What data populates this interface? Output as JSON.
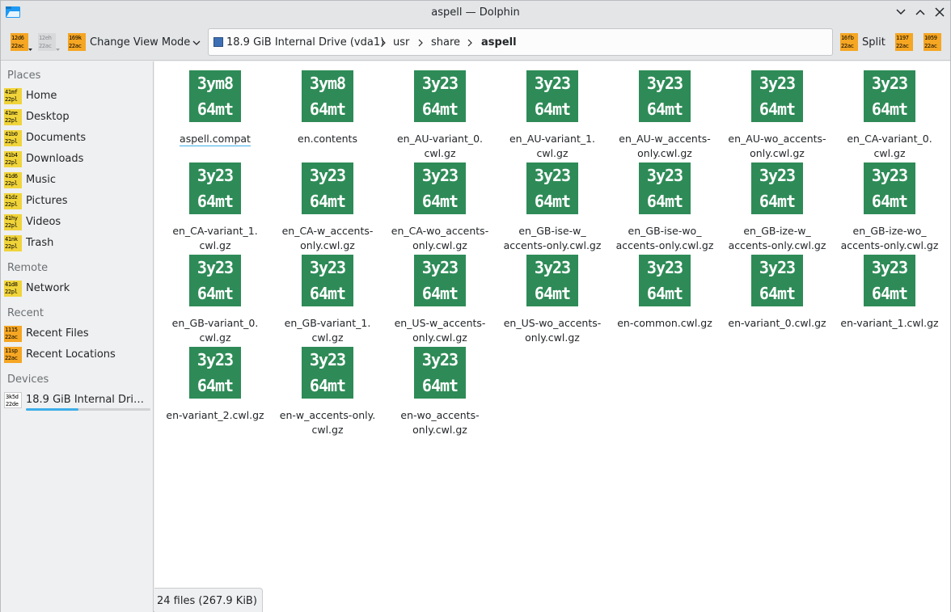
{
  "window": {
    "title": "aspell — Dolphin"
  },
  "toolbar": {
    "back_icon": [
      "12d6",
      "22ac"
    ],
    "forward_icon": [
      "12eh",
      "22ac"
    ],
    "view_mode_icon": [
      "169k",
      "22ac"
    ],
    "view_mode_label": "Change View Mode",
    "split_icon": [
      "16fb",
      "22ac"
    ],
    "split_label": "Split",
    "search_icon": [
      "1197",
      "22ac"
    ],
    "menu_icon": [
      "1059",
      "22ac"
    ]
  },
  "breadcrumb": {
    "drive": "18.9 GiB Internal Drive (vda1)",
    "items": [
      "usr",
      "share",
      "aspell"
    ]
  },
  "sidebar": {
    "sections": {
      "places": "Places",
      "remote": "Remote",
      "recent": "Recent",
      "devices": "Devices"
    },
    "places": [
      {
        "label": "Home",
        "icon": [
          "41mf",
          "22pl"
        ]
      },
      {
        "label": "Desktop",
        "icon": [
          "41me",
          "22pl"
        ]
      },
      {
        "label": "Documents",
        "icon": [
          "41b0",
          "22pl"
        ]
      },
      {
        "label": "Downloads",
        "icon": [
          "41b4",
          "22pl"
        ]
      },
      {
        "label": "Music",
        "icon": [
          "41d6",
          "22pl"
        ]
      },
      {
        "label": "Pictures",
        "icon": [
          "41dz",
          "22pl"
        ]
      },
      {
        "label": "Videos",
        "icon": [
          "41hy",
          "22pl"
        ]
      },
      {
        "label": "Trash",
        "icon": [
          "41nk",
          "22pl"
        ]
      }
    ],
    "remote": [
      {
        "label": "Network",
        "icon": [
          "41d8",
          "22pl"
        ]
      }
    ],
    "recent": [
      {
        "label": "Recent Files",
        "icon": [
          "1115",
          "22ac"
        ]
      },
      {
        "label": "Recent Locations",
        "icon": [
          "11sp",
          "22ac"
        ]
      }
    ],
    "devices": [
      {
        "label": "18.9 GiB Internal Drive ...",
        "icon": [
          "3k5d",
          "22de"
        ],
        "usage_fraction": 0.42
      }
    ]
  },
  "files": [
    {
      "name": "aspell.compat",
      "thumb": [
        "3ym8",
        "64mt"
      ]
    },
    {
      "name": "en.contents",
      "thumb": [
        "3ym8",
        "64mt"
      ]
    },
    {
      "name": "en_AU-variant_0.\ncwl.gz",
      "thumb": [
        "3y23",
        "64mt"
      ]
    },
    {
      "name": "en_AU-variant_1.\ncwl.gz",
      "thumb": [
        "3y23",
        "64mt"
      ]
    },
    {
      "name": "en_AU-w_accents-\nonly.cwl.gz",
      "thumb": [
        "3y23",
        "64mt"
      ]
    },
    {
      "name": "en_AU-wo_accents-\nonly.cwl.gz",
      "thumb": [
        "3y23",
        "64mt"
      ]
    },
    {
      "name": "en_CA-variant_0.\ncwl.gz",
      "thumb": [
        "3y23",
        "64mt"
      ]
    },
    {
      "name": "en_CA-variant_1.\ncwl.gz",
      "thumb": [
        "3y23",
        "64mt"
      ]
    },
    {
      "name": "en_CA-w_accents-\nonly.cwl.gz",
      "thumb": [
        "3y23",
        "64mt"
      ]
    },
    {
      "name": "en_CA-wo_accents-\nonly.cwl.gz",
      "thumb": [
        "3y23",
        "64mt"
      ]
    },
    {
      "name": "en_GB-ise-w_\naccents-only.cwl.gz",
      "thumb": [
        "3y23",
        "64mt"
      ]
    },
    {
      "name": "en_GB-ise-wo_\naccents-only.cwl.gz",
      "thumb": [
        "3y23",
        "64mt"
      ]
    },
    {
      "name": "en_GB-ize-w_\naccents-only.cwl.gz",
      "thumb": [
        "3y23",
        "64mt"
      ]
    },
    {
      "name": "en_GB-ize-wo_\naccents-only.cwl.gz",
      "thumb": [
        "3y23",
        "64mt"
      ]
    },
    {
      "name": "en_GB-variant_0.\ncwl.gz",
      "thumb": [
        "3y23",
        "64mt"
      ]
    },
    {
      "name": "en_GB-variant_1.\ncwl.gz",
      "thumb": [
        "3y23",
        "64mt"
      ]
    },
    {
      "name": "en_US-w_accents-\nonly.cwl.gz",
      "thumb": [
        "3y23",
        "64mt"
      ]
    },
    {
      "name": "en_US-wo_accents-\nonly.cwl.gz",
      "thumb": [
        "3y23",
        "64mt"
      ]
    },
    {
      "name": "en-common.cwl.gz",
      "thumb": [
        "3y23",
        "64mt"
      ]
    },
    {
      "name": "en-variant_0.cwl.gz",
      "thumb": [
        "3y23",
        "64mt"
      ]
    },
    {
      "name": "en-variant_1.cwl.gz",
      "thumb": [
        "3y23",
        "64mt"
      ]
    },
    {
      "name": "en-variant_2.cwl.gz",
      "thumb": [
        "3y23",
        "64mt"
      ]
    },
    {
      "name": "en-w_accents-only.\ncwl.gz",
      "thumb": [
        "3y23",
        "64mt"
      ]
    },
    {
      "name": "en-wo_accents-\nonly.cwl.gz",
      "thumb": [
        "3y23",
        "64mt"
      ]
    }
  ],
  "status": {
    "summary": "24 files (267.9 KiB)"
  },
  "colors": {
    "accent": "#3daee9",
    "thumb_bg": "#2e8b57",
    "placeholder_icon": "#f0d43a",
    "toolbar_icon": "#f5a623"
  }
}
